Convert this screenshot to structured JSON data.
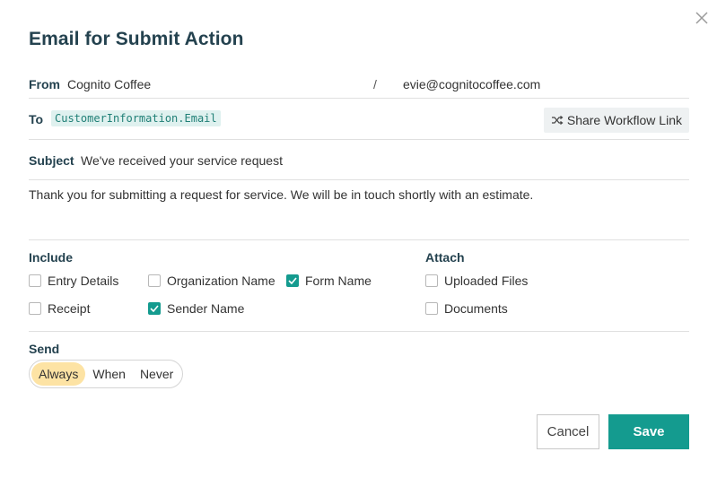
{
  "dialog": {
    "title": "Email for Submit Action"
  },
  "from": {
    "label": "From",
    "name": "Cognito Coffee",
    "separator": "/",
    "email": "evie@cognitocoffee.com"
  },
  "to": {
    "label": "To",
    "value": "CustomerInformation.Email",
    "share_button": "Share Workflow Link"
  },
  "subject": {
    "label": "Subject",
    "value": "We've received your service request"
  },
  "message": {
    "body": "Thank you for submitting a request for service. We will be in touch shortly with an estimate."
  },
  "include": {
    "label": "Include",
    "options": [
      {
        "label": "Entry Details",
        "checked": false
      },
      {
        "label": "Organization Name",
        "checked": false
      },
      {
        "label": "Form Name",
        "checked": true
      },
      {
        "label": "Receipt",
        "checked": false
      },
      {
        "label": "Sender Name",
        "checked": true
      }
    ]
  },
  "attach": {
    "label": "Attach",
    "options": [
      {
        "label": "Uploaded Files",
        "checked": false
      },
      {
        "label": "Documents",
        "checked": false
      }
    ]
  },
  "send": {
    "label": "Send",
    "options": [
      "Always",
      "When",
      "Never"
    ],
    "selected": "Always"
  },
  "actions": {
    "cancel": "Cancel",
    "save": "Save"
  },
  "colors": {
    "accent": "#149b8f",
    "title": "#24424f",
    "send_active": "#fde3a4",
    "chip_bg": "#dff1ef"
  },
  "icons": {
    "close": "close-icon",
    "share": "shuffle-icon",
    "check": "checkmark-icon"
  }
}
